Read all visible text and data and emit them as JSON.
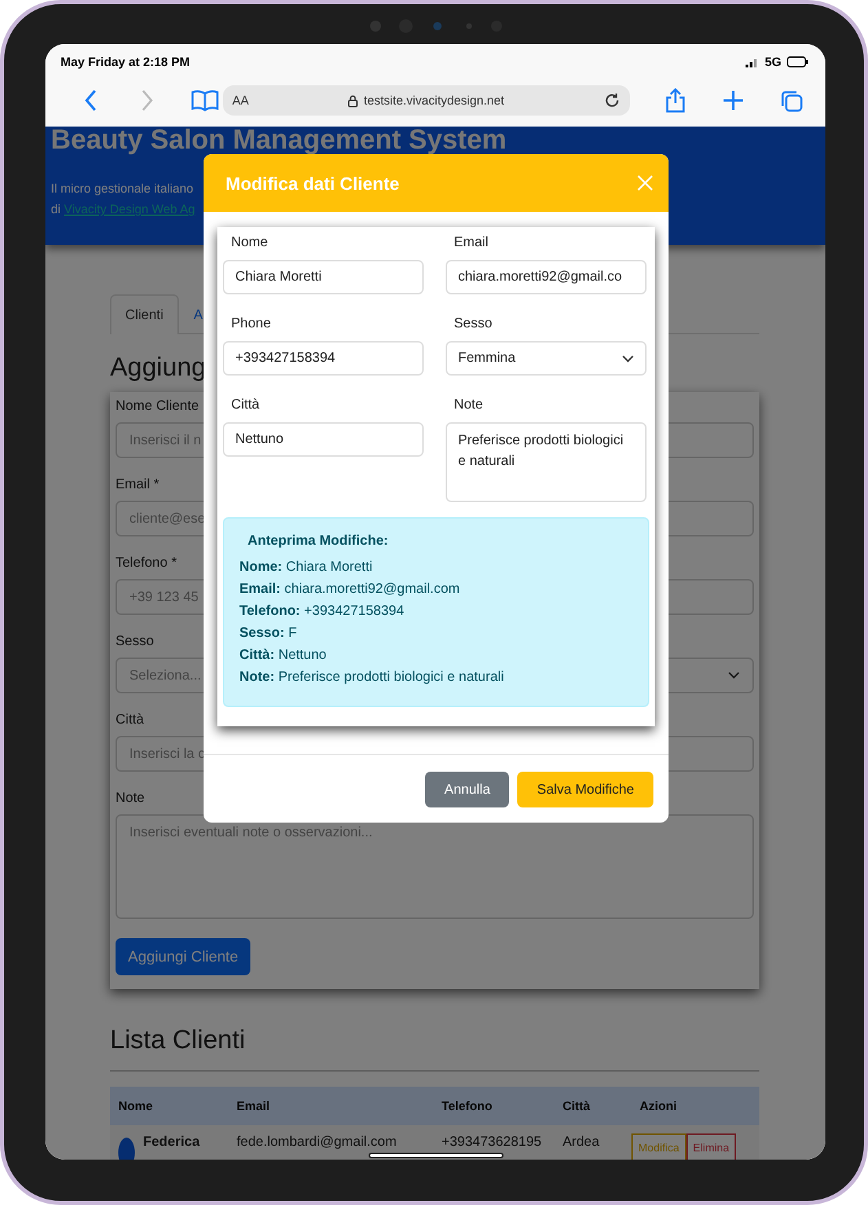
{
  "status_bar": {
    "time": "May Friday at 2:18 PM",
    "network": "5G"
  },
  "browser": {
    "text_size": "AA",
    "url": "testsite.vivacitydesign.net"
  },
  "header": {
    "title": "Beauty Salon Management System",
    "subtitle": "Il micro gestionale italiano",
    "byline": "di",
    "link": "Vivacity Design Web Ag"
  },
  "tabs": [
    {
      "label": "Clienti",
      "selected": true
    },
    {
      "label": "A",
      "selected": false
    }
  ],
  "form": {
    "title": "Aggiung",
    "fields": [
      {
        "label": "Nome Cliente",
        "placeholder": "Inserisci il n",
        "kind": "input"
      },
      {
        "label": "Email *",
        "placeholder": "cliente@ese",
        "kind": "input"
      },
      {
        "label": "Telefono *",
        "placeholder": "+39 123 45",
        "kind": "input"
      },
      {
        "label": "Sesso",
        "placeholder": "Seleziona...",
        "kind": "select"
      },
      {
        "label": "Città",
        "placeholder": "Inserisci la c",
        "kind": "input"
      },
      {
        "label": "Note",
        "placeholder": "Inserisci eventuali note o osservazioni...",
        "kind": "textarea"
      }
    ],
    "submit": "Aggiungi Cliente"
  },
  "client_list": {
    "title": "Lista Clienti",
    "columns": [
      "Nome",
      "Email",
      "Telefono",
      "Città",
      "Azioni"
    ],
    "rows": [
      {
        "name": "Federica",
        "email": "fede.lombardi@gmail.com",
        "phone": "+393473628195",
        "city": "Ardea",
        "actions": [
          "Modifica",
          "Elimina"
        ]
      }
    ]
  },
  "modal": {
    "title": "Modifica dati Cliente",
    "fields": [
      {
        "label": "Nome",
        "value": "Chiara Moretti",
        "kind": "input"
      },
      {
        "label": "Email",
        "value": "chiara.moretti92@gmail.co",
        "kind": "input"
      },
      {
        "label": "Phone",
        "value": "+393427158394",
        "kind": "input"
      },
      {
        "label": "Sesso",
        "value": "Femmina",
        "kind": "select"
      },
      {
        "label": "Città",
        "value": "Nettuno",
        "kind": "input"
      },
      {
        "label": "Note",
        "value": "Preferisce prodotti biologici e naturali",
        "kind": "textarea"
      }
    ],
    "preview": {
      "title": "Anteprima Modifiche:",
      "items": [
        {
          "label": "Nome:",
          "value": "Chiara Moretti"
        },
        {
          "label": "Email:",
          "value": "chiara.moretti92@gmail.com"
        },
        {
          "label": "Telefono:",
          "value": "+393427158394"
        },
        {
          "label": "Sesso:",
          "value": "F"
        },
        {
          "label": "Città:",
          "value": "Nettuno"
        },
        {
          "label": "Note:",
          "value": "Preferisce prodotti biologici e naturali"
        }
      ]
    },
    "buttons": [
      {
        "label": "Annulla",
        "kind": "secondary"
      },
      {
        "label": "Salva Modifiche",
        "kind": "primary"
      }
    ]
  }
}
